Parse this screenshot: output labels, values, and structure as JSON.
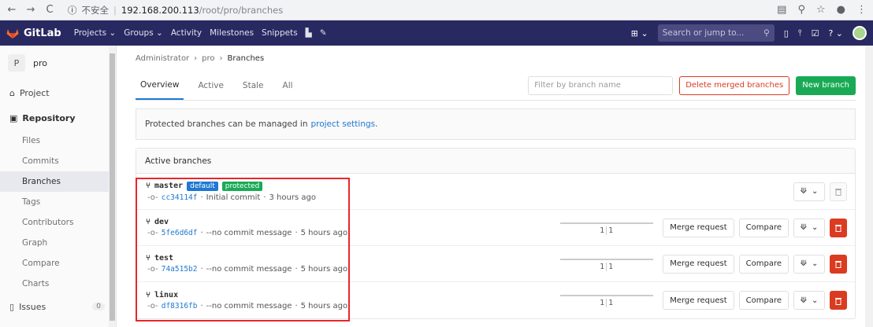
{
  "browser": {
    "insecure_label": "不安全",
    "host": "192.168.200.113",
    "path": "/root/pro/branches"
  },
  "header": {
    "brand": "GitLab",
    "nav": [
      "Projects ⌄",
      "Groups ⌄",
      "Activity",
      "Milestones",
      "Snippets"
    ],
    "search_placeholder": "Search or jump to..."
  },
  "sidebar": {
    "project_initial": "P",
    "project_name": "pro",
    "project_label": "Project",
    "repository_label": "Repository",
    "repo_items": [
      "Files",
      "Commits",
      "Branches",
      "Tags",
      "Contributors",
      "Graph",
      "Compare",
      "Charts"
    ],
    "active_item": "Branches",
    "issues_label": "Issues",
    "issues_count": "0"
  },
  "breadcrumb": [
    "Administrator",
    "pro",
    "Branches"
  ],
  "tabs": [
    "Overview",
    "Active",
    "Stale",
    "All"
  ],
  "filter_placeholder": "Filter by branch name",
  "delete_merged_label": "Delete merged branches",
  "new_branch_label": "New branch",
  "notice": {
    "text": "Protected branches can be managed in",
    "link": "project settings",
    "end": "."
  },
  "panel_title": "Active branches",
  "labels": {
    "merge_request": "Merge request",
    "compare": "Compare"
  },
  "branches": [
    {
      "name": "master",
      "badges": [
        "default",
        "protected"
      ],
      "sha": "cc34114f",
      "message": "Initial commit",
      "time": "3 hours ago",
      "behind": "",
      "ahead": "",
      "deletable": false
    },
    {
      "name": "dev",
      "badges": [],
      "sha": "5fe6d6df",
      "message": "--no commit message",
      "time": "5 hours ago",
      "behind": "1",
      "ahead": "1",
      "deletable": true
    },
    {
      "name": "test",
      "badges": [],
      "sha": "74a515b2",
      "message": "--no commit message",
      "time": "5 hours ago",
      "behind": "1",
      "ahead": "1",
      "deletable": true
    },
    {
      "name": "linux",
      "badges": [],
      "sha": "df8316fb",
      "message": "--no commit message",
      "time": "5 hours ago",
      "behind": "1",
      "ahead": "1",
      "deletable": true
    }
  ],
  "colors": {
    "header": "#292961",
    "link": "#1f78d1",
    "success": "#1aaa55",
    "danger": "#db3b21",
    "highlight": "#e8262b"
  }
}
